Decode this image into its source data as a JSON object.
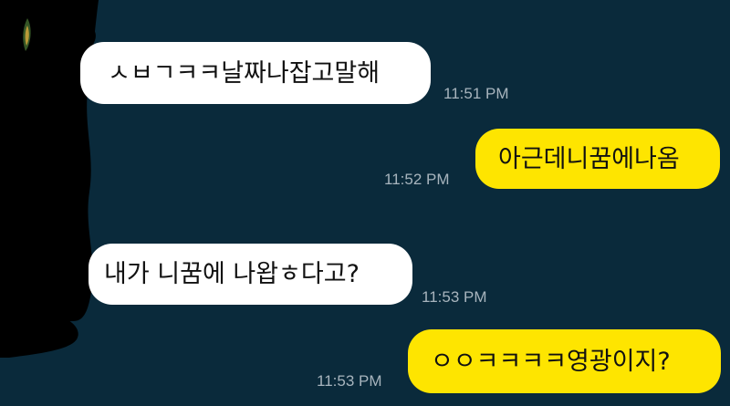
{
  "chat": {
    "messages": [
      {
        "sender": "other",
        "text": "ㅅㅂㄱㅋㅋ날짜나잡고말해",
        "time": "11:51 PM"
      },
      {
        "sender": "me",
        "text": "아근데니꿈에나옴",
        "time": "11:52 PM"
      },
      {
        "sender": "other",
        "text": "내가 니꿈에 나왑ㅎ다고?",
        "time": "11:53 PM"
      },
      {
        "sender": "me",
        "text": "ㅇㅇㅋㅋㅋㅋ영광이지?",
        "time": "11:53 PM"
      }
    ]
  },
  "colors": {
    "background": "#0a2a3b",
    "incoming_bubble": "#ffffff",
    "outgoing_bubble": "#fee500",
    "timestamp": "#a7b4bd",
    "redaction": "#000000"
  }
}
